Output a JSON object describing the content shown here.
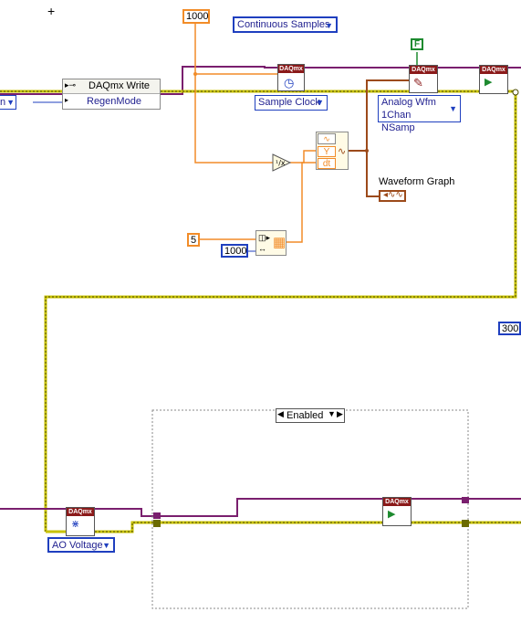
{
  "constants": {
    "samples_1000": "1000",
    "rate_1000": "1000",
    "five": "5",
    "timeout_300": "300",
    "f_bool": "F"
  },
  "rings": {
    "sample_mode": "Continuous Samples",
    "timing_type": "Sample Clock",
    "read_type": "Analog Wfm\n1Chan NSamp",
    "channel_type": "AO Voltage",
    "left_partial": "n"
  },
  "nodes": {
    "daqmx_write_title": "DAQmx Write",
    "daqmx_write_property": "RegenMode",
    "waveform_graph_label": "Waveform Graph",
    "build_waveform_y": "Y",
    "build_waveform_dt": "dt",
    "daq_header": "DAQmx"
  },
  "structure": {
    "disable_selector": "Enabled"
  },
  "colors": {
    "wire_task": "#7a1f6e",
    "wire_error": "#c8c200",
    "wire_numeric": "#f28c28",
    "wire_waveform": "#9c4a1a",
    "frame_border": "#8a8a8a"
  }
}
